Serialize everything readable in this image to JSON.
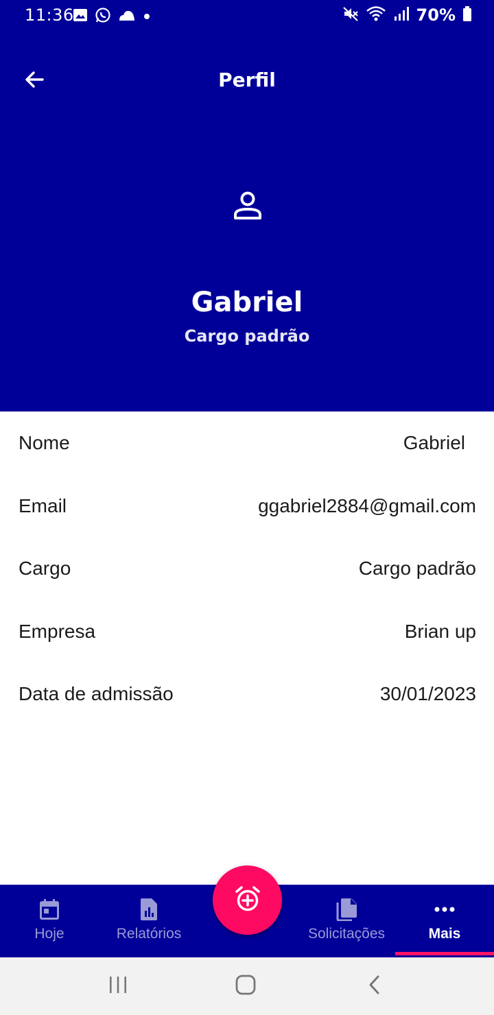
{
  "status_bar": {
    "time": "11:36",
    "battery": "70%",
    "icons_left": [
      "image-icon",
      "whatsapp-icon",
      "cloud-icon",
      "dot-icon"
    ],
    "icons_right": [
      "mute-icon",
      "wifi-icon",
      "signal-icon",
      "battery-icon"
    ]
  },
  "header": {
    "title": "Perfil",
    "back_icon": "arrow-left-icon",
    "avatar_icon": "person-icon",
    "name": "Gabriel",
    "role": "Cargo padrão",
    "background_color": "#000099"
  },
  "details": [
    {
      "label": "Nome",
      "value": "Gabriel"
    },
    {
      "label": "Email",
      "value": "ggabriel2884@gmail.com"
    },
    {
      "label": "Cargo",
      "value": "Cargo padrão"
    },
    {
      "label": "Empresa",
      "value": "Brian up"
    },
    {
      "label": "Data de admissão",
      "value": "30/01/2023"
    }
  ],
  "bottom_nav": {
    "items": [
      {
        "label": "Hoje",
        "icon": "calendar-icon"
      },
      {
        "label": "Relatórios",
        "icon": "report-icon"
      },
      {
        "label": "Solicitações",
        "icon": "documents-icon"
      },
      {
        "label": "Mais",
        "icon": "more-icon",
        "active": true
      }
    ],
    "fab_icon": "alarm-add-icon",
    "accent_color": "#ff0a63"
  },
  "system_nav": [
    "recents-icon",
    "home-icon",
    "back-icon"
  ]
}
